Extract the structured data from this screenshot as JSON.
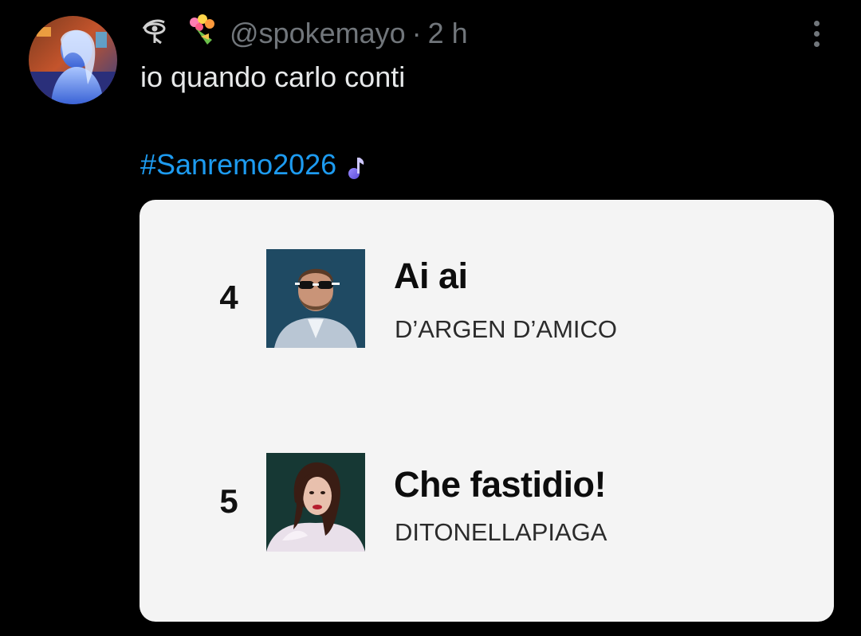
{
  "post": {
    "name_emojis": "👁 💐",
    "handle": "@spokemayo",
    "separator": "·",
    "time": "2 h",
    "text": "io quando carlo conti",
    "hashtag": "#Sanremo2026",
    "hashtag_color": "#1d9bf0",
    "accent_text_color": "#71767b"
  },
  "media": {
    "chart_entries": [
      {
        "rank": "4",
        "title": "Ai ai",
        "artist": "D’ARGEN D’AMICO"
      },
      {
        "rank": "5",
        "title": "Che fastidio!",
        "artist": "DITONELLAPIAGA"
      }
    ]
  },
  "icons": {
    "avatar": "profile-avatar",
    "more": "more-options-icon",
    "music_note": "music-note-icon"
  }
}
